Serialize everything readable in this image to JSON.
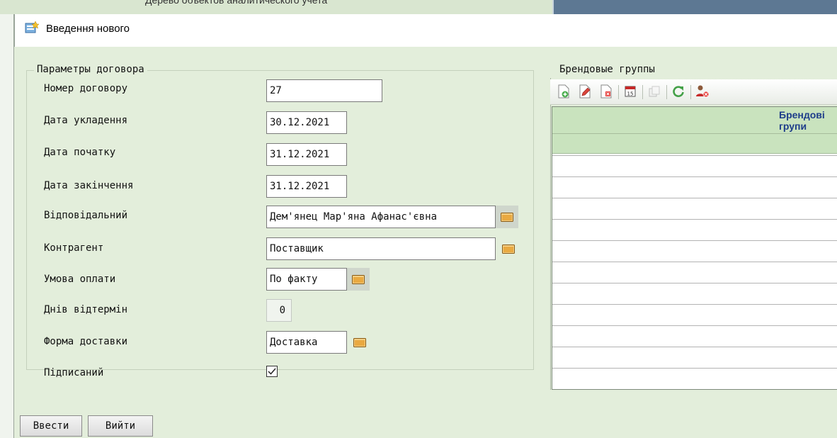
{
  "background_window": {
    "title": "Дерево объектов аналитического учета"
  },
  "dialog": {
    "title": "Введення нового"
  },
  "contract_params": {
    "legend": "Параметры договора",
    "fields": {
      "number": {
        "label": "Номер договору",
        "value": "27"
      },
      "conclusion_date": {
        "label": "Дата укладення",
        "value": "30.12.2021"
      },
      "start_date": {
        "label": "Дата початку",
        "value": "31.12.2021"
      },
      "end_date": {
        "label": "Дата закінчення",
        "value": "31.12.2021"
      },
      "responsible": {
        "label": "Відповідальний",
        "value": "Дем'янец Мар'яна Афанас'євна"
      },
      "counterparty": {
        "label": "Контрагент",
        "value": "Поставщик"
      },
      "payment_terms": {
        "label": "Умова оплати",
        "value": "По факту"
      },
      "deferral_days": {
        "label": "Днів відтермін",
        "value": "0"
      },
      "delivery_form": {
        "label": "Форма доставки",
        "value": "Доставка"
      },
      "signed": {
        "label": "Підписаний",
        "checked": true
      }
    }
  },
  "brand_groups": {
    "legend": "Брендовые группы",
    "toolbar_icons": [
      "add-icon",
      "edit-icon",
      "delete-icon",
      "calendar-icon",
      "copy-icon",
      "refresh-icon",
      "user-remove-icon"
    ],
    "column_header": "Брендові групи",
    "rows": []
  },
  "buttons": {
    "submit": "Ввести",
    "exit": "Вийти"
  },
  "colors": {
    "background": "#e3eedb",
    "grid_header": "#c9e3be",
    "header_text": "#1e3d8a"
  }
}
